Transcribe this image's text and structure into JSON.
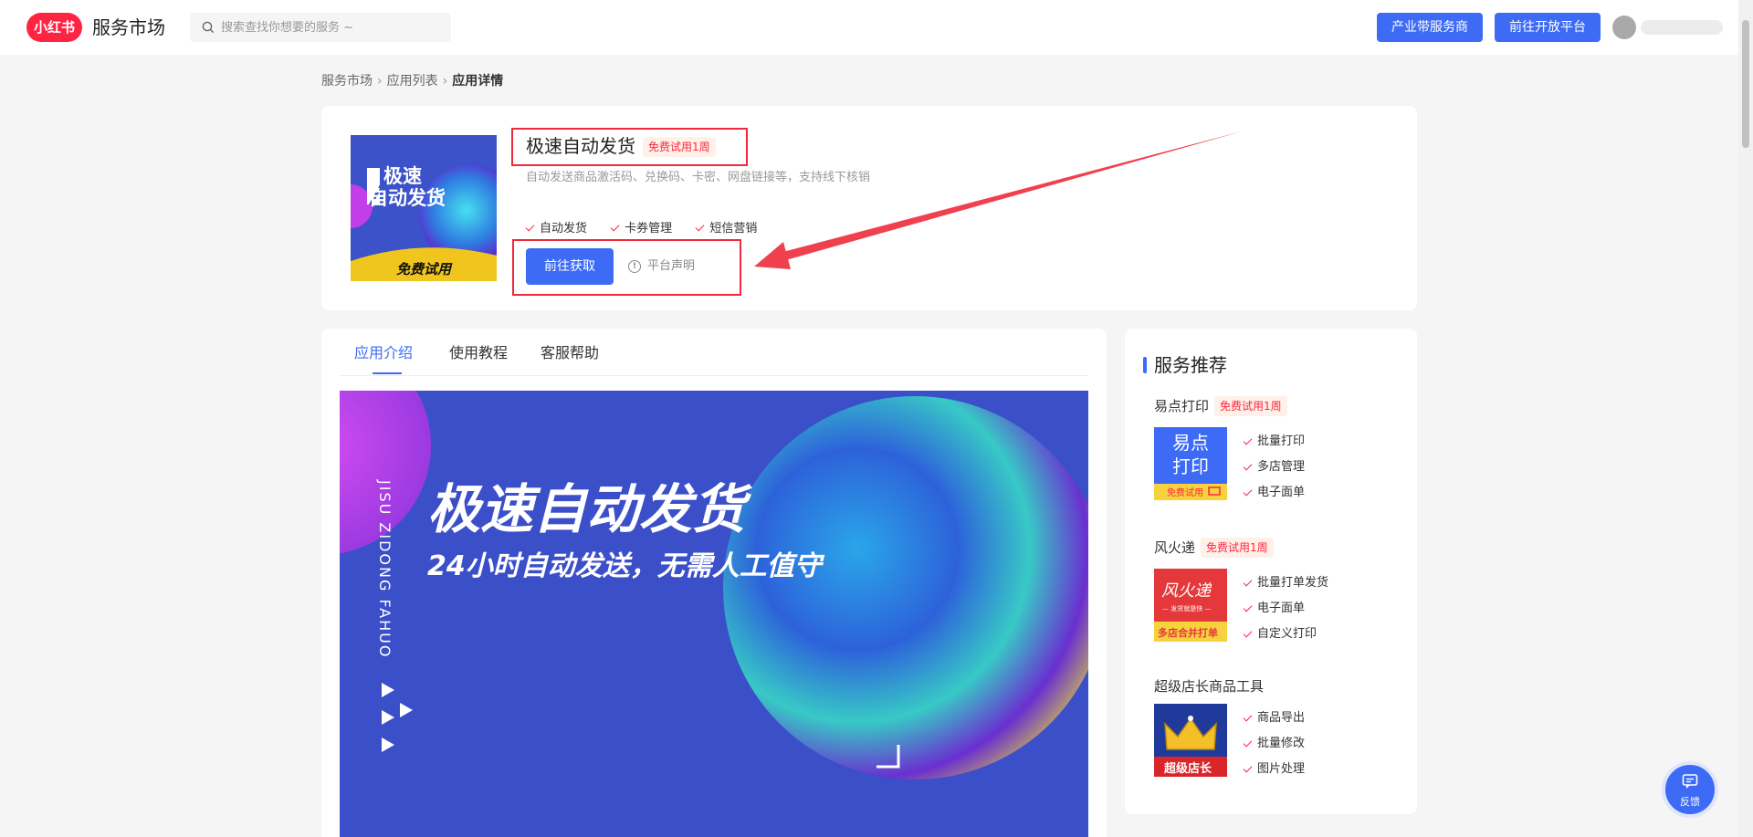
{
  "header": {
    "logo_text": "小红书",
    "brand": "服务市场",
    "search_placeholder": "搜索查找你想要的服务 ~",
    "btn_industry": "产业带服务商",
    "btn_open_platform": "前往开放平台"
  },
  "breadcrumb": [
    "服务市场",
    "应用列表",
    "应用详情"
  ],
  "app": {
    "name": "极速自动发货",
    "trial_tag": "免费试用1周",
    "description": "自动发送商品激活码、兑换码、卡密、网盘链接等，支持线下核销",
    "features": [
      "自动发货",
      "卡券管理",
      "短信营销"
    ],
    "get_button": "前往获取",
    "notice": "平台声明",
    "cover": {
      "line1": "极速",
      "line2": "自动发货",
      "badge": "免费试用"
    }
  },
  "tabs": [
    "应用介绍",
    "使用教程",
    "客服帮助"
  ],
  "banner": {
    "title": "极速自动发货",
    "subtitle": "24小时自动发送，无需人工值守",
    "vertical_text": "JISU ZIDONG FAHUO"
  },
  "sidebar": {
    "title": "服务推荐",
    "items": [
      {
        "name": "易点打印",
        "tag": "免费试用1周",
        "features": [
          "批量打印",
          "多店管理",
          "电子面单"
        ],
        "img_line1": "易点",
        "img_line2": "打印",
        "img_badge": "免费试用"
      },
      {
        "name": "风火递",
        "tag": "免费试用1周",
        "features": [
          "批量打单发货",
          "电子面单",
          "自定义打印"
        ],
        "img_line1": "风火递",
        "img_line2": "— 发货就是快 —",
        "img_badge": "多店合并打单"
      },
      {
        "name": "超级店长商品工具",
        "tag": "",
        "features": [
          "商品导出",
          "批量修改",
          "图片处理"
        ],
        "img_badge": "超级店长"
      }
    ]
  },
  "feedback": "反馈",
  "colors": {
    "accent": "#3d6bf5",
    "brand": "#ff2442",
    "highlight": "#f0283c"
  }
}
